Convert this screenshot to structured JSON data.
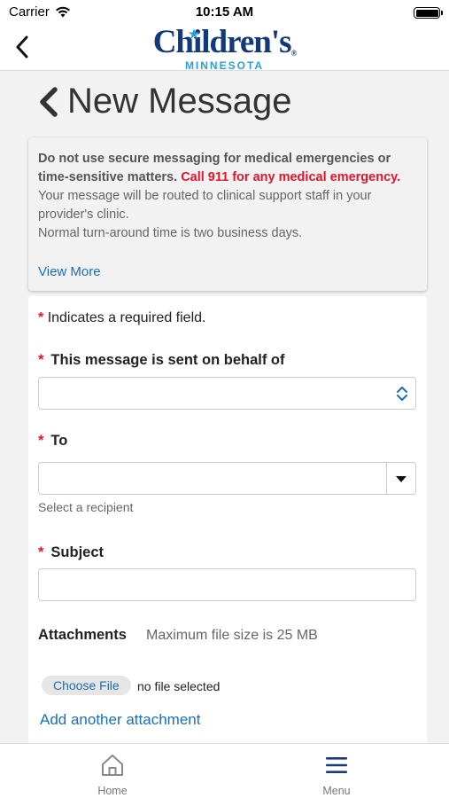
{
  "status_bar": {
    "carrier": "Carrier",
    "time": "10:15 AM"
  },
  "header": {
    "logo_main": "Children's",
    "logo_registered": "®",
    "logo_sub": "MINNESOTA"
  },
  "page": {
    "title": "New Message"
  },
  "notice": {
    "bold_text": "Do not use secure messaging for medical emergencies or time-sensitive matters.",
    "emergency_text": "Call 911 for any medical emergency.",
    "routing_text": "Your message will be routed to clinical support staff in your provider's clinic.",
    "turnaround_text": "Normal turn-around time is two business days.",
    "view_more": "View More"
  },
  "form": {
    "required_star": "*",
    "required_note": "Indicates a required field.",
    "behalf_label": "This message is sent on behalf of",
    "behalf_value": "",
    "to_label": "To",
    "to_value": "",
    "to_hint": "Select a recipient",
    "subject_label": "Subject",
    "subject_value": "",
    "attachments_label": "Attachments",
    "attachments_hint": "Maximum file size is 25 MB",
    "choose_file": "Choose File",
    "no_file": "no file selected",
    "add_attachment": "Add another attachment"
  },
  "tab_bar": {
    "home_label": "Home",
    "menu_label": "Menu"
  },
  "colors": {
    "brand_navy": "#123a7a",
    "brand_light_blue": "#2a9fd8",
    "link_blue": "#1b6fb3",
    "emergency_red": "#e0162b"
  }
}
